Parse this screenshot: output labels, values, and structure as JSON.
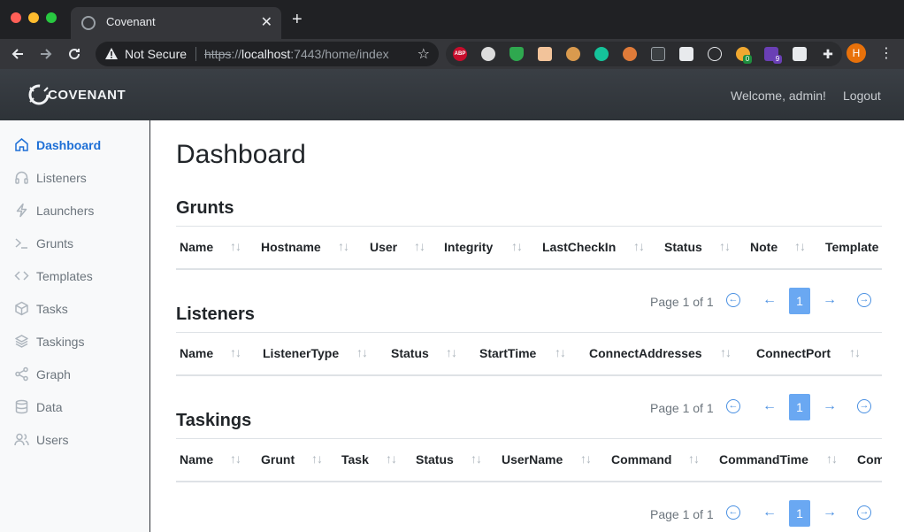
{
  "browser": {
    "tab_title": "Covenant",
    "close_glyph": "✕",
    "new_tab_glyph": "+",
    "security_label": "Not Secure",
    "url_scheme": "https",
    "url_sep": "://",
    "url_host": "localhost",
    "url_rest": ":7443/home/index",
    "ext_abp_label": "ABP",
    "ext_badge_1": "0",
    "ext_badge_2": "9",
    "profile_initial": "H"
  },
  "header": {
    "brand": "COVENANT",
    "welcome": "Welcome, admin!",
    "logout": "Logout"
  },
  "sidebar": {
    "items": [
      {
        "label": "Dashboard",
        "icon": "home-icon",
        "active": true
      },
      {
        "label": "Listeners",
        "icon": "headphones-icon"
      },
      {
        "label": "Launchers",
        "icon": "lightning-icon"
      },
      {
        "label": "Grunts",
        "icon": "terminal-icon"
      },
      {
        "label": "Templates",
        "icon": "code-icon"
      },
      {
        "label": "Tasks",
        "icon": "box-icon"
      },
      {
        "label": "Taskings",
        "icon": "layers-icon"
      },
      {
        "label": "Graph",
        "icon": "share-icon"
      },
      {
        "label": "Data",
        "icon": "database-icon"
      },
      {
        "label": "Users",
        "icon": "users-icon"
      }
    ]
  },
  "main": {
    "title": "Dashboard",
    "grunts": {
      "title": "Grunts",
      "columns": [
        "Name",
        "Hostname",
        "User",
        "Integrity",
        "LastCheckIn",
        "Status",
        "Note",
        "Template"
      ],
      "page_label": "Page 1 of 1",
      "page_current": "1"
    },
    "listeners": {
      "title": "Listeners",
      "columns": [
        "Name",
        "ListenerType",
        "Status",
        "StartTime",
        "ConnectAddresses",
        "ConnectPort"
      ],
      "page_label": "Page 1 of 1",
      "page_current": "1"
    },
    "taskings": {
      "title": "Taskings",
      "columns": [
        "Name",
        "Grunt",
        "Task",
        "Status",
        "UserName",
        "Command",
        "CommandTime",
        "Com"
      ],
      "page_label": "Page 1 of 1",
      "page_current": "1"
    },
    "sort_glyph": "↑↓",
    "pager_first_glyph": "←",
    "pager_prev_glyph": "←",
    "pager_next_glyph": "→",
    "pager_last_glyph": "→"
  },
  "colors": {
    "accent": "#1d6fd6",
    "pager_active": "#6aa8f2",
    "header_bg": "#343a40"
  }
}
